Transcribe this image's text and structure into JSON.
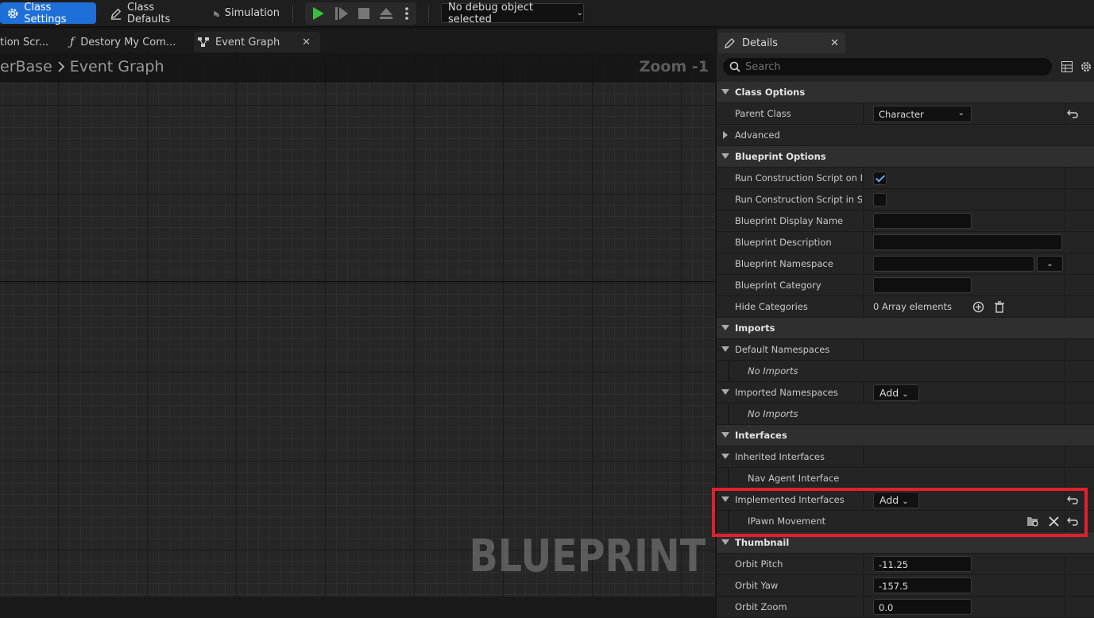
{
  "toolbar": {
    "class_settings": "Class Settings",
    "class_defaults": "Class Defaults",
    "simulation": "Simulation",
    "debug_select": "No debug object selected"
  },
  "tabs": [
    {
      "label": "tion Scr..."
    },
    {
      "label": "Destory My Com..."
    },
    {
      "label": "Event Graph"
    }
  ],
  "graph": {
    "breadcrumb_parent": "erBase",
    "breadcrumb_current": "Event Graph",
    "zoom": "Zoom -1",
    "watermark": "BLUEPRINT"
  },
  "details": {
    "tab_label": "Details",
    "search_placeholder": "Search",
    "class_options": "Class Options",
    "parent_class_label": "Parent Class",
    "parent_class_value": "Character",
    "advanced": "Advanced",
    "blueprint_options": "Blueprint Options",
    "run_cs_drag": "Run Construction Script on Drag",
    "run_cs_seq": "Run Construction Script in Seq...",
    "bp_display_name": "Blueprint Display Name",
    "bp_description": "Blueprint Description",
    "bp_namespace": "Blueprint Namespace",
    "bp_category": "Blueprint Category",
    "hide_categories": "Hide Categories",
    "array_elements": "0 Array elements",
    "imports": "Imports",
    "default_namespaces": "Default Namespaces",
    "no_imports_1": "No Imports",
    "imported_namespaces": "Imported Namespaces",
    "add_label_1": "Add",
    "no_imports_2": "No Imports",
    "interfaces": "Interfaces",
    "inherited_interfaces": "Inherited Interfaces",
    "nav_agent_interface": "Nav Agent Interface",
    "implemented_interfaces": "Implemented Interfaces",
    "add_label_2": "Add",
    "ipawn_movement": "IPawn Movement",
    "thumbnail": "Thumbnail",
    "orbit_pitch_label": "Orbit Pitch",
    "orbit_pitch_value": "-11.25",
    "orbit_yaw_label": "Orbit Yaw",
    "orbit_yaw_value": "-157.5",
    "orbit_zoom_label": "Orbit Zoom",
    "orbit_zoom_value": "0.0"
  },
  "colors": {
    "accent": "#1f6fd9",
    "highlight": "#e0202e",
    "play_green": "#3cbf3c"
  }
}
